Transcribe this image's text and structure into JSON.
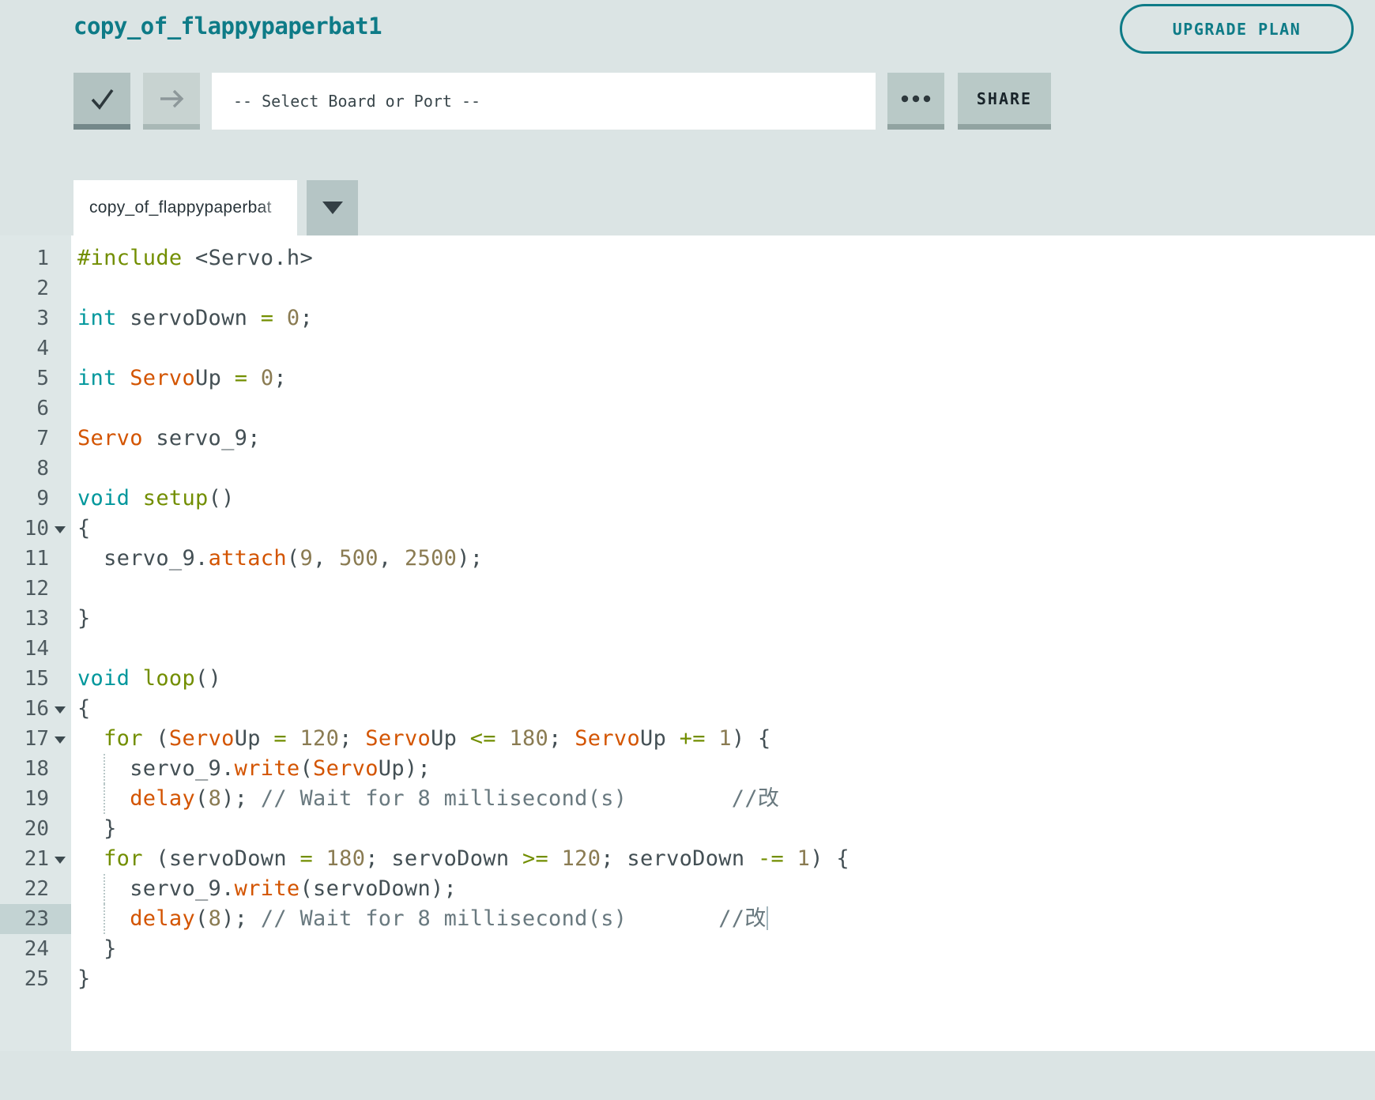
{
  "header": {
    "title": "copy_of_flappypaperbat1",
    "upgrade_label": "UPGRADE PLAN"
  },
  "toolbar": {
    "verify_icon": "check-icon",
    "upload_icon": "arrow-right-icon",
    "board_select_placeholder": "-- Select Board or Port --",
    "more_icon": "ellipsis-icon",
    "share_label": "SHARE"
  },
  "tabs": {
    "active_label": "copy_of_flappypaperbat",
    "dropdown_icon": "chevron-down-icon"
  },
  "colors": {
    "accent_teal": "#0e7b87",
    "page_bg": "#dbe4e4",
    "token_type": "#00979c",
    "token_keyword": "#728e00",
    "token_function": "#d35400",
    "token_number": "#8a7b52",
    "token_comment": "#69797f",
    "token_plain": "#434f54",
    "gutter_bg": "#dee7e7",
    "gutter_active_bg": "#c3d3d3"
  },
  "editor": {
    "active_line": 23,
    "lines": [
      {
        "n": 1,
        "t": [
          [
            "g",
            "#include"
          ],
          [
            "p",
            " <Servo.h>"
          ]
        ]
      },
      {
        "n": 2,
        "t": []
      },
      {
        "n": 3,
        "t": [
          [
            "k",
            "int"
          ],
          [
            "p",
            " servoDown "
          ],
          [
            "g",
            "="
          ],
          [
            "p",
            " "
          ],
          [
            "n",
            "0"
          ],
          [
            "p",
            ";"
          ]
        ]
      },
      {
        "n": 4,
        "t": []
      },
      {
        "n": 5,
        "t": [
          [
            "k",
            "int"
          ],
          [
            "p",
            " "
          ],
          [
            "o",
            "Servo"
          ],
          [
            "p",
            "Up "
          ],
          [
            "g",
            "="
          ],
          [
            "p",
            " "
          ],
          [
            "n",
            "0"
          ],
          [
            "p",
            ";"
          ]
        ]
      },
      {
        "n": 6,
        "t": []
      },
      {
        "n": 7,
        "t": [
          [
            "o",
            "Servo"
          ],
          [
            "p",
            " servo_9;"
          ]
        ]
      },
      {
        "n": 8,
        "t": []
      },
      {
        "n": 9,
        "t": [
          [
            "k",
            "void"
          ],
          [
            "p",
            " "
          ],
          [
            "g",
            "setup"
          ],
          [
            "p",
            "()"
          ]
        ]
      },
      {
        "n": 10,
        "fold": true,
        "t": [
          [
            "p",
            "{"
          ]
        ]
      },
      {
        "n": 11,
        "t": [
          [
            "p",
            "  servo_9."
          ],
          [
            "o",
            "attach"
          ],
          [
            "p",
            "("
          ],
          [
            "n",
            "9"
          ],
          [
            "p",
            ", "
          ],
          [
            "n",
            "500"
          ],
          [
            "p",
            ", "
          ],
          [
            "n",
            "2500"
          ],
          [
            "p",
            ");"
          ]
        ]
      },
      {
        "n": 12,
        "t": []
      },
      {
        "n": 13,
        "t": [
          [
            "p",
            "}"
          ]
        ]
      },
      {
        "n": 14,
        "t": []
      },
      {
        "n": 15,
        "t": [
          [
            "k",
            "void"
          ],
          [
            "p",
            " "
          ],
          [
            "g",
            "loop"
          ],
          [
            "p",
            "()"
          ]
        ]
      },
      {
        "n": 16,
        "fold": true,
        "t": [
          [
            "p",
            "{"
          ]
        ]
      },
      {
        "n": 17,
        "fold": true,
        "t": [
          [
            "p",
            "  "
          ],
          [
            "g",
            "for"
          ],
          [
            "p",
            " ("
          ],
          [
            "o",
            "Servo"
          ],
          [
            "p",
            "Up "
          ],
          [
            "g",
            "="
          ],
          [
            "p",
            " "
          ],
          [
            "n",
            "120"
          ],
          [
            "p",
            "; "
          ],
          [
            "o",
            "Servo"
          ],
          [
            "p",
            "Up "
          ],
          [
            "g",
            "<="
          ],
          [
            "p",
            " "
          ],
          [
            "n",
            "180"
          ],
          [
            "p",
            "; "
          ],
          [
            "o",
            "Servo"
          ],
          [
            "p",
            "Up "
          ],
          [
            "g",
            "+="
          ],
          [
            "p",
            " "
          ],
          [
            "n",
            "1"
          ],
          [
            "p",
            ") {"
          ]
        ]
      },
      {
        "n": 18,
        "guide": true,
        "t": [
          [
            "p",
            "    servo_9."
          ],
          [
            "o",
            "write"
          ],
          [
            "p",
            "("
          ],
          [
            "o",
            "Servo"
          ],
          [
            "p",
            "Up);"
          ]
        ]
      },
      {
        "n": 19,
        "guide": true,
        "t": [
          [
            "p",
            "    "
          ],
          [
            "o",
            "delay"
          ],
          [
            "p",
            "("
          ],
          [
            "n",
            "8"
          ],
          [
            "p",
            "); "
          ],
          [
            "c",
            "// Wait for 8 millisecond(s)        //改"
          ]
        ]
      },
      {
        "n": 20,
        "t": [
          [
            "p",
            "  }"
          ]
        ]
      },
      {
        "n": 21,
        "fold": true,
        "t": [
          [
            "p",
            "  "
          ],
          [
            "g",
            "for"
          ],
          [
            "p",
            " (servoDown "
          ],
          [
            "g",
            "="
          ],
          [
            "p",
            " "
          ],
          [
            "n",
            "180"
          ],
          [
            "p",
            "; servoDown "
          ],
          [
            "g",
            ">="
          ],
          [
            "p",
            " "
          ],
          [
            "n",
            "120"
          ],
          [
            "p",
            "; servoDown "
          ],
          [
            "g",
            "-="
          ],
          [
            "p",
            " "
          ],
          [
            "n",
            "1"
          ],
          [
            "p",
            ") {"
          ]
        ]
      },
      {
        "n": 22,
        "guide": true,
        "t": [
          [
            "p",
            "    servo_9."
          ],
          [
            "o",
            "write"
          ],
          [
            "p",
            "(servoDown);"
          ]
        ]
      },
      {
        "n": 23,
        "guide": true,
        "active": true,
        "cursor": true,
        "t": [
          [
            "p",
            "    "
          ],
          [
            "o",
            "delay"
          ],
          [
            "p",
            "("
          ],
          [
            "n",
            "8"
          ],
          [
            "p",
            "); "
          ],
          [
            "c",
            "// Wait for 8 millisecond(s)       //改"
          ]
        ]
      },
      {
        "n": 24,
        "t": [
          [
            "p",
            "  }"
          ]
        ]
      },
      {
        "n": 25,
        "t": [
          [
            "p",
            "}"
          ]
        ]
      }
    ]
  }
}
